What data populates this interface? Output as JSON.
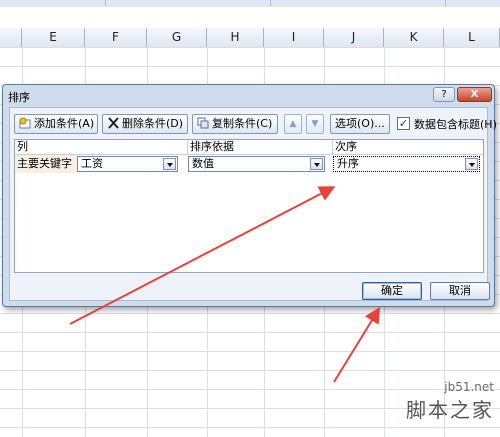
{
  "sheet": {
    "columns": [
      "E",
      "F",
      "G",
      "H",
      "I",
      "J",
      "K",
      "L"
    ]
  },
  "dialog": {
    "title": "排序",
    "help_label": "?",
    "close_label": "X",
    "toolbar": {
      "add_label": "添加条件(A)",
      "delete_label": "删除条件(D)",
      "copy_label": "复制条件(C)",
      "move_up_label": "▲",
      "move_down_label": "▼",
      "options_label": "选项(O)...",
      "header_checkbox_checked": true,
      "header_checkbox_mark": "✓",
      "header_checkbox_label": "数据包含标题(H)"
    },
    "table": {
      "headers": [
        "列",
        "排序依据",
        "次序"
      ],
      "rows": [
        {
          "key_label": "主要关键字",
          "column": "工资",
          "sort_on": "数值",
          "order": "升序"
        }
      ]
    },
    "ok_label": "确定",
    "cancel_label": "取消"
  },
  "watermark": {
    "line1": "jb51.net",
    "line2": "脚本之家"
  },
  "colors": {
    "arrow": "#e8413c",
    "dialog_bg": "#cfdcec",
    "accent_border": "#5b7aa3"
  }
}
